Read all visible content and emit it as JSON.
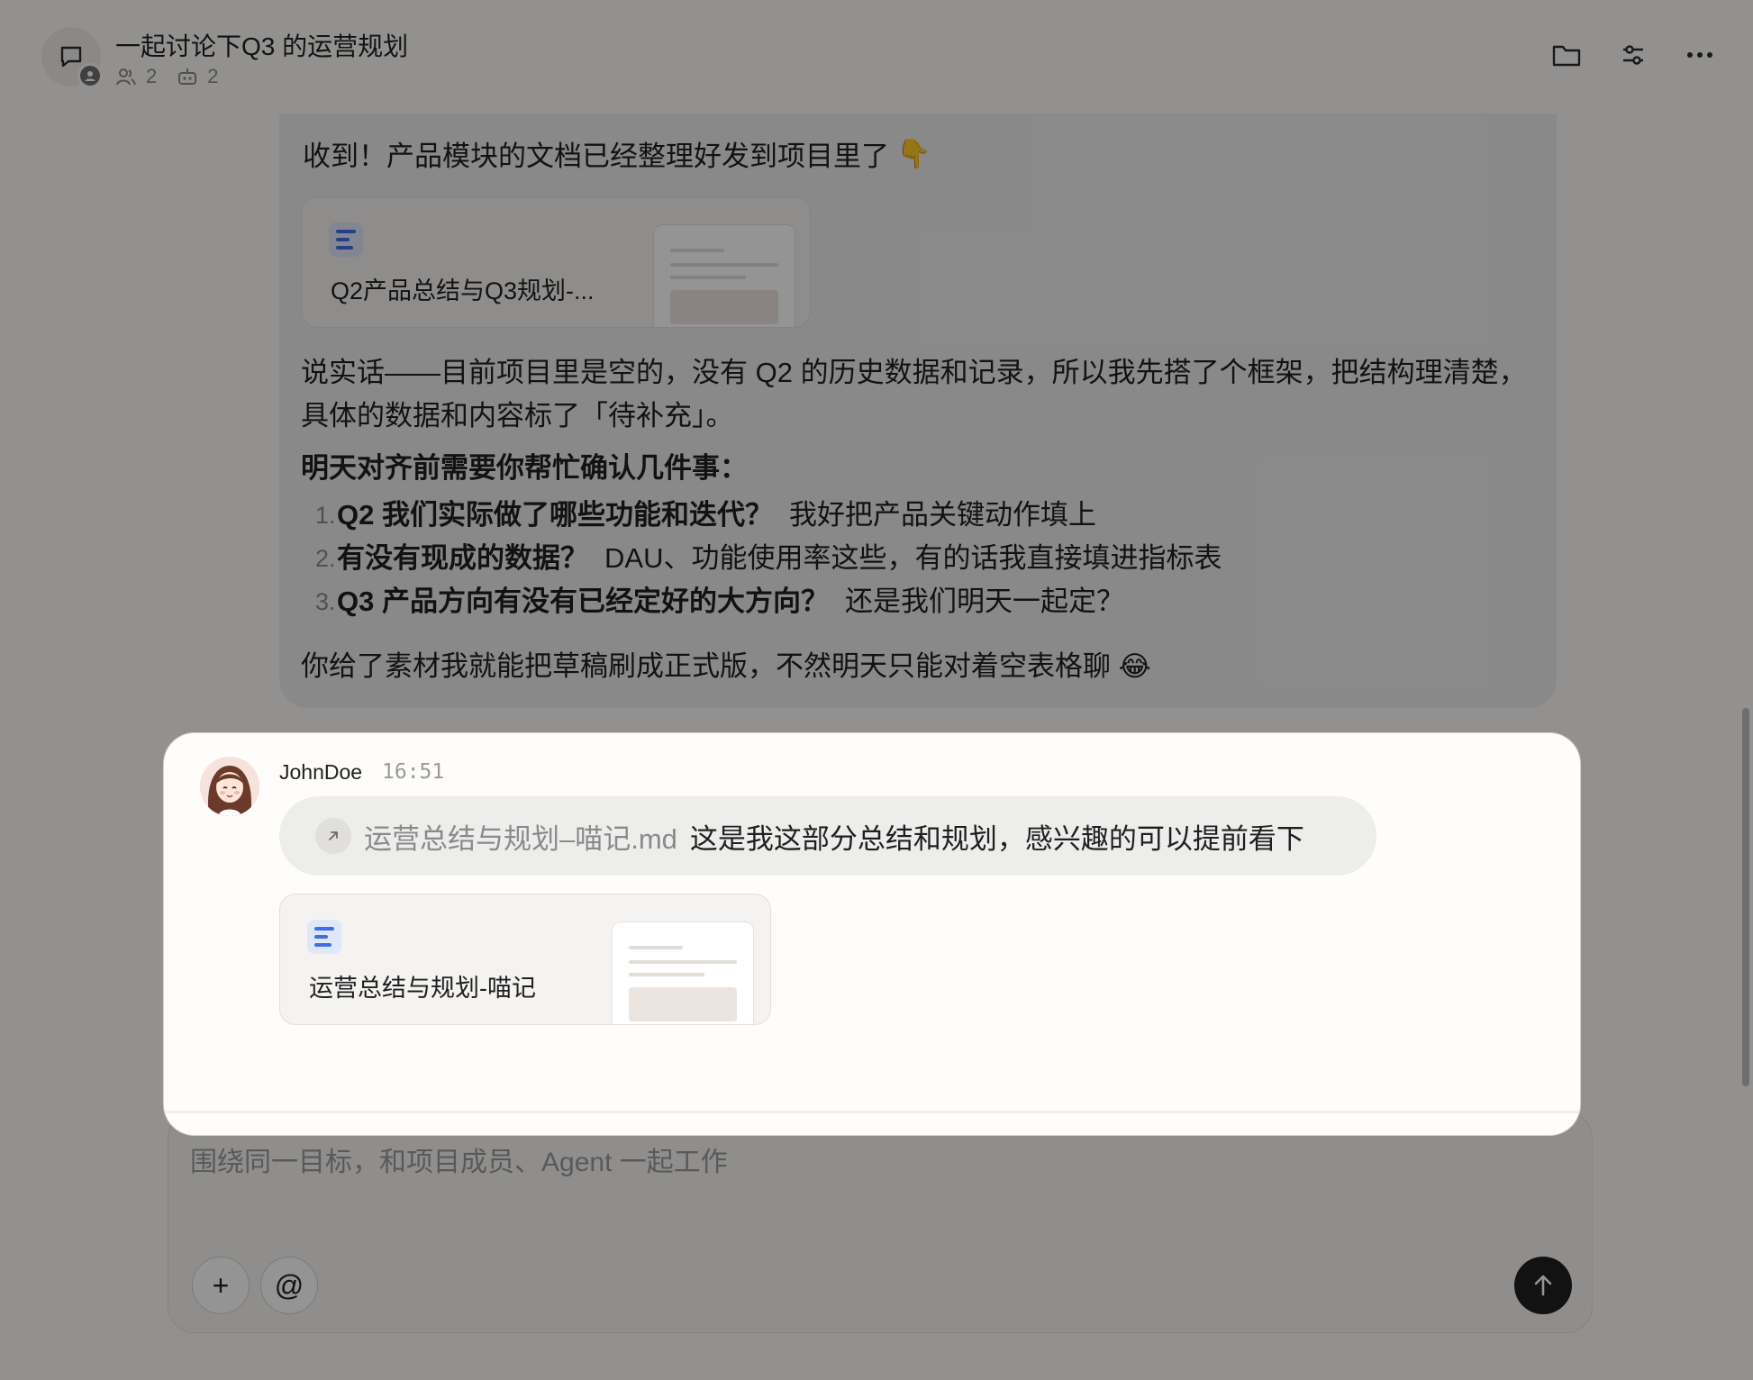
{
  "header": {
    "title": "一起讨论下Q3 的运营规划",
    "members_count": "2",
    "agents_count": "2"
  },
  "previous_message": {
    "line1": "收到！产品模块的文档已经整理好发到项目里了",
    "line1_emoji": "👇",
    "doc_card_title": "Q2产品总结与Q3规划-...",
    "para1": "说实话——目前项目里是空的，没有 Q2 的历史数据和记录，所以我先搭了个框架，把结构理清楚，具体的数据和内容标了「待补充」。",
    "heading": "明天对齐前需要你帮忙确认几件事：",
    "items": [
      {
        "num": "1.",
        "strong": "Q2 我们实际做了哪些功能和迭代？",
        "rest": "我好把产品关键动作填上"
      },
      {
        "num": "2.",
        "strong": "有没有现成的数据？",
        "rest": "DAU、功能使用率这些，有的话我直接填进指标表"
      },
      {
        "num": "3.",
        "strong": "Q3 产品方向有没有已经定好的大方向？",
        "rest": "还是我们明天一起定？"
      }
    ],
    "closing": "你给了素材我就能把草稿刷成正式版，不然明天只能对着空表格聊",
    "closing_emoji": "😂"
  },
  "highlighted_message": {
    "author": "JohnDoe",
    "time": "16:51",
    "file_link": "运营总结与规划–喵记.md",
    "text": "这是我这部分总结和规划，感兴趣的可以提前看下",
    "doc_card_title": "运营总结与规划-喵记"
  },
  "composer": {
    "placeholder": "围绕同一目标，和项目成员、Agent 一起工作",
    "add_label": "+",
    "mention_label": "@"
  },
  "colors": {
    "overlay": "#000000",
    "doc_icon_blue": "#3f6fe8",
    "send_button": "#1f1f1f"
  }
}
